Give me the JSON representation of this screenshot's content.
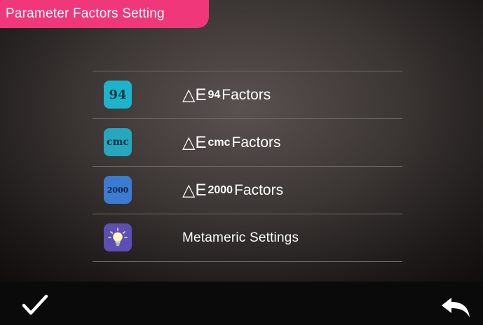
{
  "header": {
    "title": "Parameter Factors Setting"
  },
  "menu": {
    "items": [
      {
        "icon": "de94-icon",
        "icon_text": "94",
        "symbol": "△E",
        "subscript": "94",
        "suffix": "Factors"
      },
      {
        "icon": "decmc-icon",
        "icon_text": "cmc",
        "symbol": "△E",
        "subscript": "cmc",
        "suffix": "Factors"
      },
      {
        "icon": "de2000-icon",
        "icon_text": "2000",
        "symbol": "△E",
        "subscript": "2000",
        "suffix": "Factors"
      },
      {
        "icon": "lightbulb-icon",
        "label": "Metameric Settings"
      }
    ]
  },
  "footer": {
    "confirm_icon": "checkmark-icon",
    "back_icon": "back-arrow-icon"
  },
  "colors": {
    "title_bg": "#f0377a",
    "icon94": "#1cb4cc",
    "iconcmc": "#27a6bf",
    "icon2000": "#3b7bd2",
    "iconmeta": "#5b4fb3"
  }
}
